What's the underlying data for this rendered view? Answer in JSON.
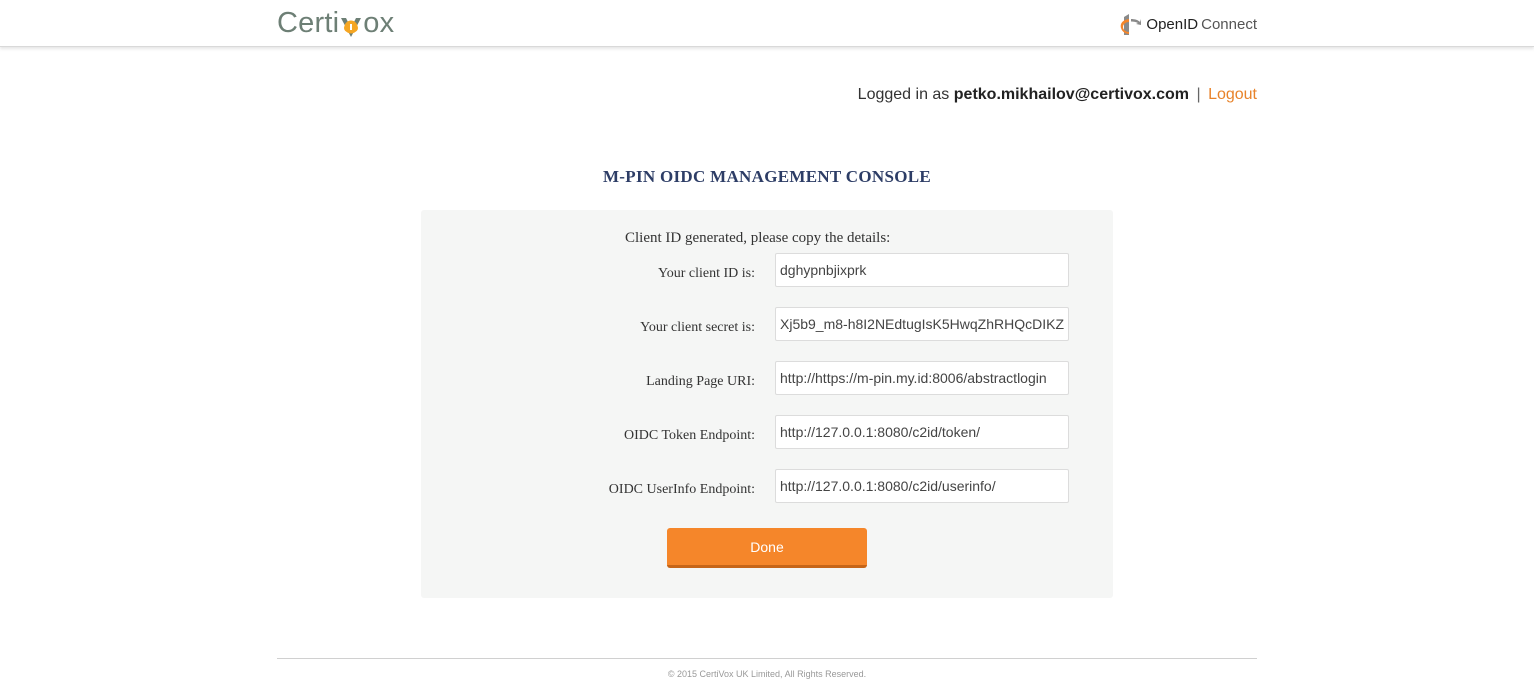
{
  "header": {
    "logo_left": "Certi",
    "logo_right": "ox",
    "openid_label": "OpenID",
    "connect_label": "Connect"
  },
  "session": {
    "logged_in_prefix": "Logged in as",
    "user_email": "petko.mikhailov@certivox.com",
    "separator": "|",
    "logout_label": "Logout"
  },
  "page_title": "M-PIN OIDC MANAGEMENT CONSOLE",
  "form": {
    "intro": "Client ID generated, please copy the details:",
    "fields": [
      {
        "label": "Your client ID is:",
        "value": "dghypnbjixprk"
      },
      {
        "label": "Your client secret is:",
        "value": "Xj5b9_m8-h8I2NEdtugIsK5HwqZhRHQcDIKZ"
      },
      {
        "label": "Landing Page URI:",
        "value": "http://https://m-pin.my.id:8006/abstractlogin"
      },
      {
        "label": "OIDC Token Endpoint:",
        "value": "http://127.0.0.1:8080/c2id/token/"
      },
      {
        "label": "OIDC UserInfo Endpoint:",
        "value": "http://127.0.0.1:8080/c2id/userinfo/"
      }
    ],
    "done_label": "Done"
  },
  "footer": {
    "copyright": "© 2015 CertiVox UK Limited, All Rights Reserved."
  },
  "colors": {
    "accent": "#f5862a",
    "title": "#2d3d66",
    "logo": "#6d7f75"
  }
}
